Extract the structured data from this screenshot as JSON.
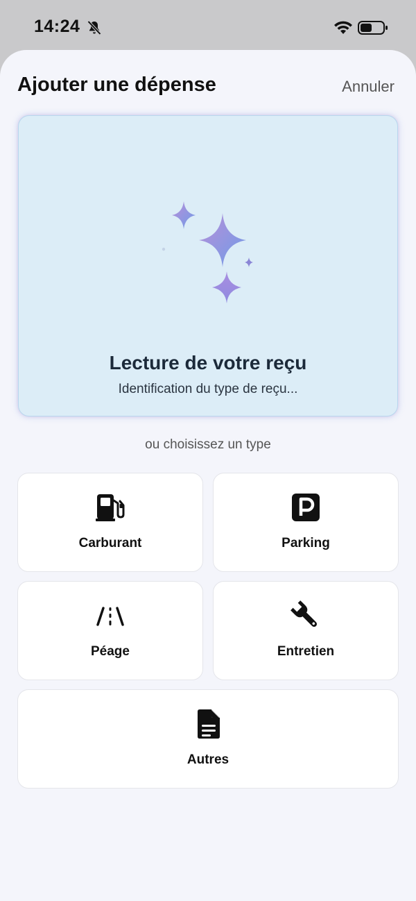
{
  "status_bar": {
    "time": "14:24"
  },
  "header": {
    "title": "Ajouter une dépense",
    "cancel_label": "Annuler"
  },
  "scan": {
    "title": "Lecture de votre reçu",
    "subtitle": "Identification du type de reçu..."
  },
  "choose_label": "ou choisissez un type",
  "types": [
    {
      "label": "Carburant",
      "icon": "fuel-pump-icon"
    },
    {
      "label": "Parking",
      "icon": "parking-icon"
    },
    {
      "label": "Péage",
      "icon": "road-icon"
    },
    {
      "label": "Entretien",
      "icon": "wrench-icon"
    },
    {
      "label": "Autres",
      "icon": "document-icon"
    }
  ],
  "colors": {
    "sheet_background": "#f4f5fb",
    "scan_card_background": "#dcedf7",
    "sparkle_gradient_start": "#b98fd8",
    "sparkle_gradient_end": "#6f9ce8"
  }
}
